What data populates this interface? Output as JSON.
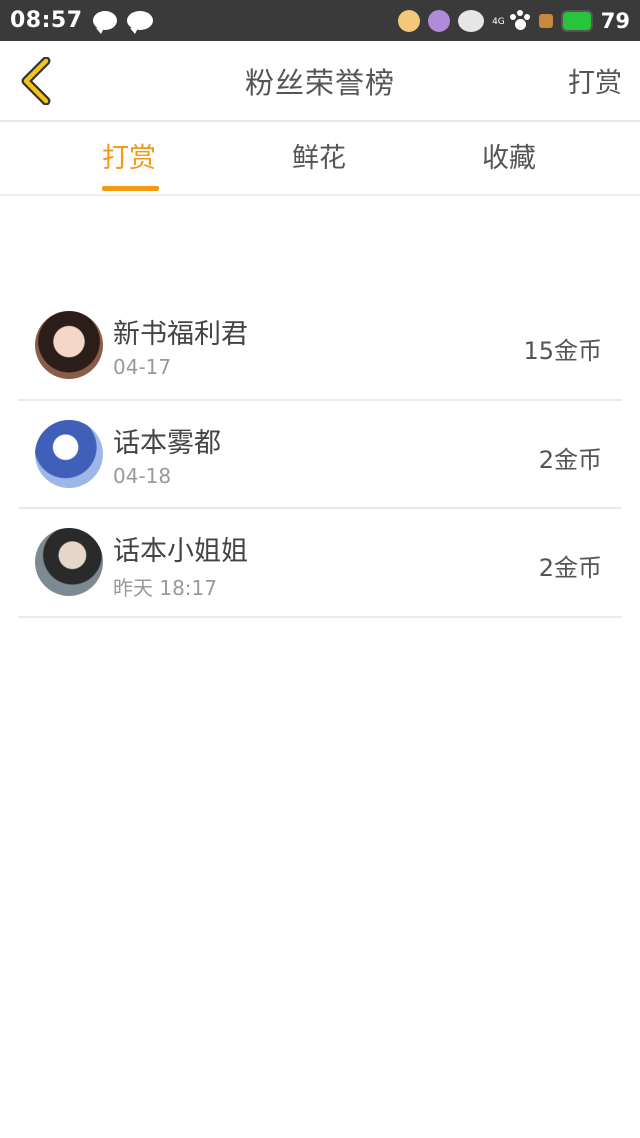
{
  "status_bar": {
    "time": "08:57",
    "network": "4G",
    "battery": "79",
    "accent_battery": "#27c43c"
  },
  "header": {
    "title": "粉丝荣誉榜",
    "action": "打赏"
  },
  "tabs": [
    {
      "label": "打赏",
      "active": true
    },
    {
      "label": "鲜花",
      "active": false
    },
    {
      "label": "收藏",
      "active": false
    }
  ],
  "list": [
    {
      "name": "新书福利君",
      "date": "04-17",
      "amount": "15金币"
    },
    {
      "name": "话本雾都",
      "date": "04-18",
      "amount": "2金币"
    },
    {
      "name": "话本小姐姐",
      "date": "昨天 18:17",
      "amount": "2金币"
    }
  ],
  "colors": {
    "accent": "#f29b12",
    "text": "#555555",
    "muted": "#999999"
  }
}
